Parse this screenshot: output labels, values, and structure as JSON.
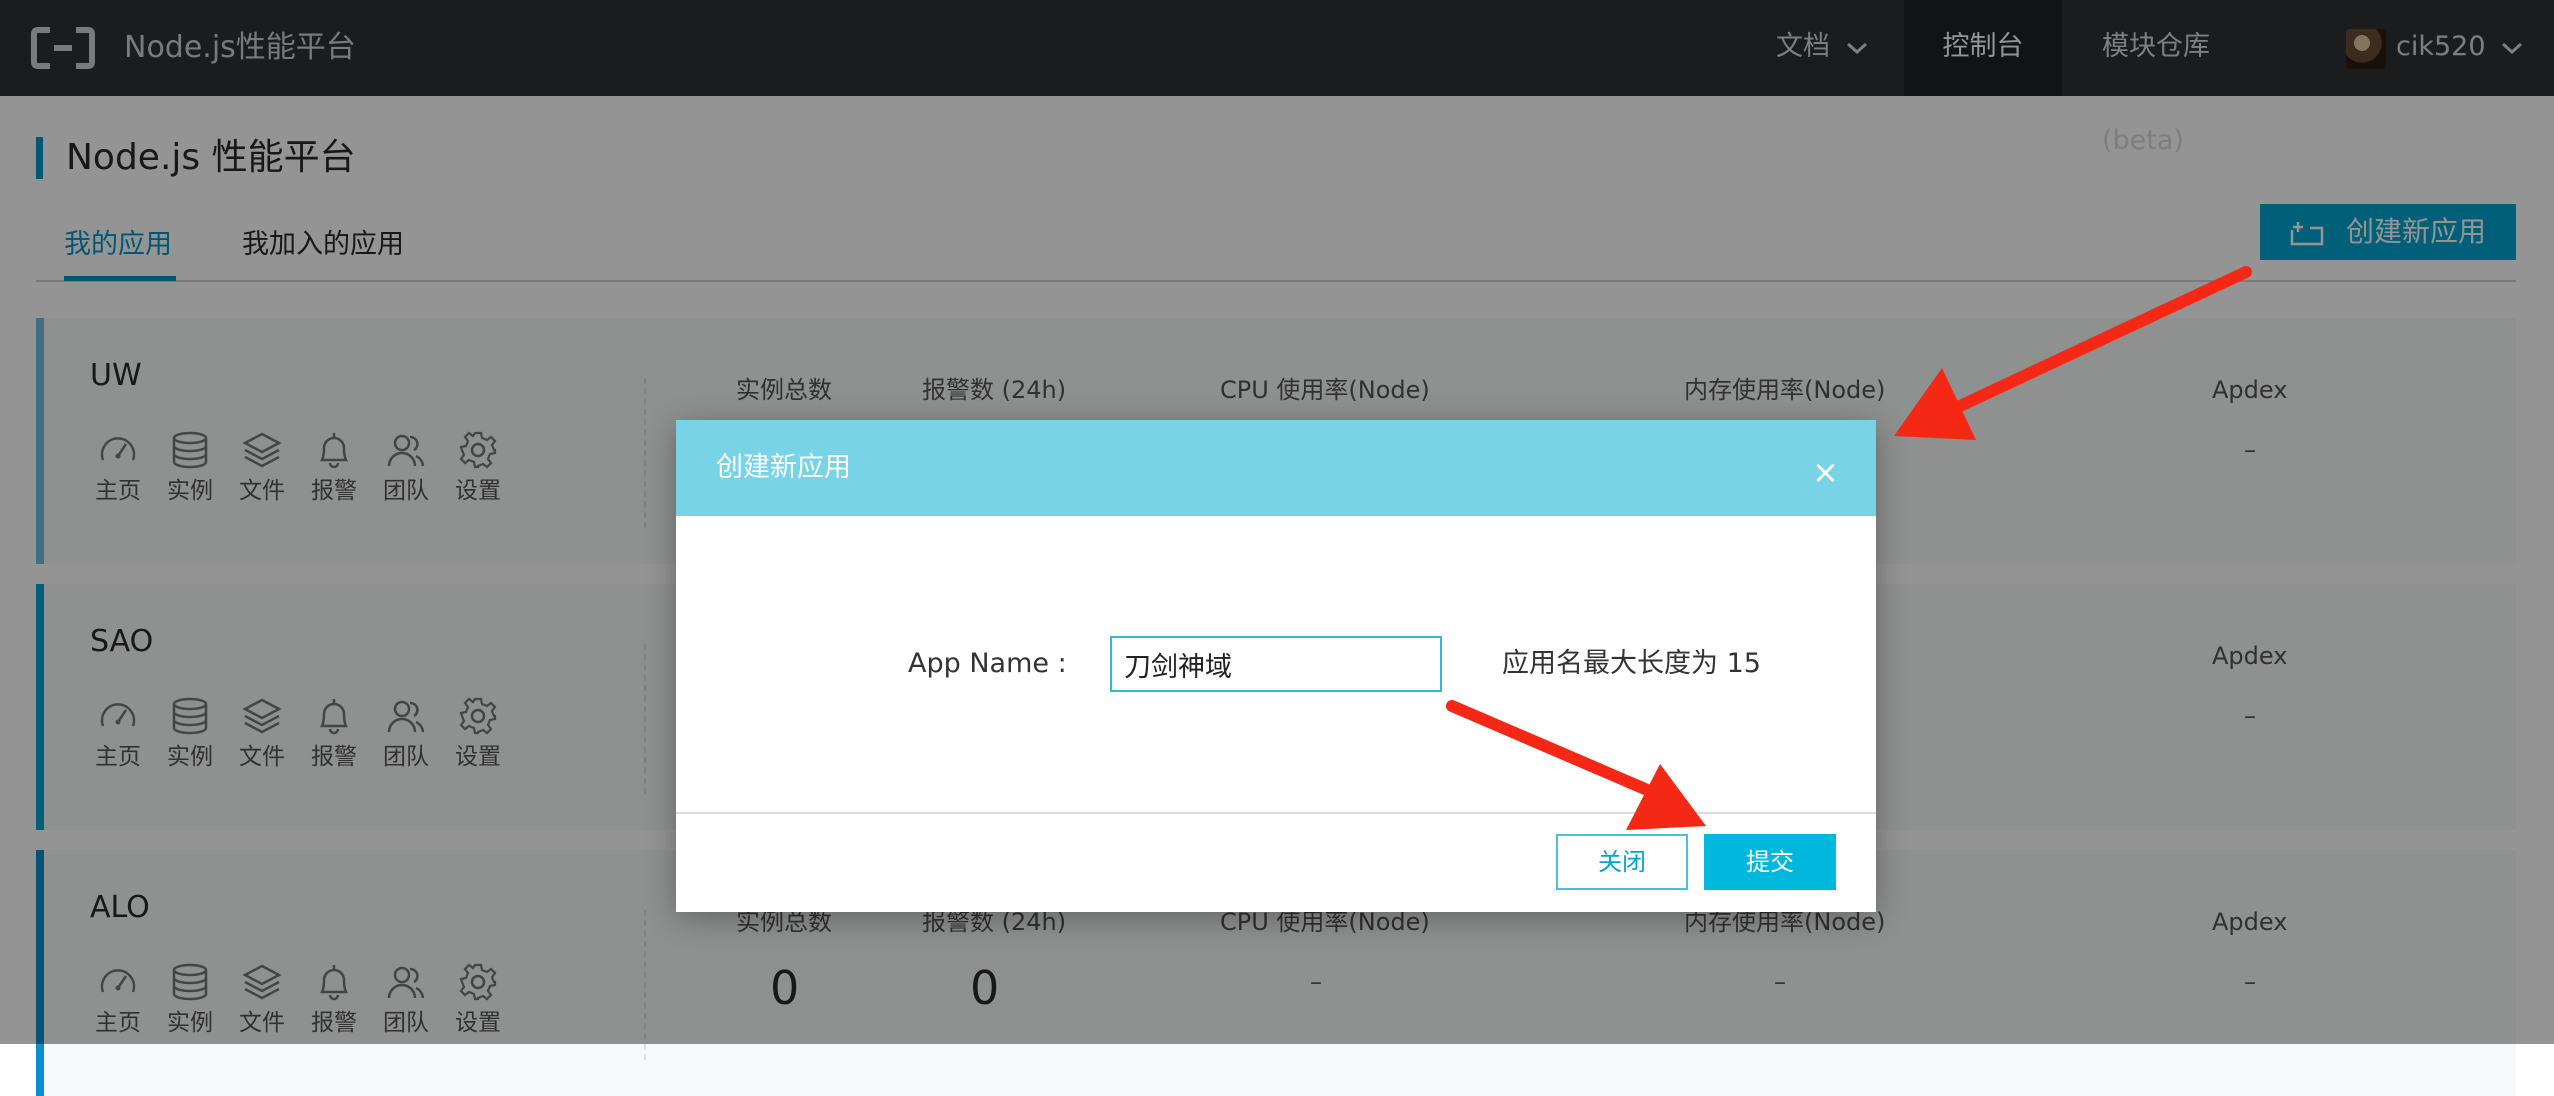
{
  "nav": {
    "brand": "Node.js性能平台",
    "docs": "文档",
    "console": "控制台",
    "modules": "模块仓库(beta)",
    "user": "cik520"
  },
  "page": {
    "title": "Node.js 性能平台",
    "tabs": [
      {
        "label": "我的应用",
        "active": true
      },
      {
        "label": "我加入的应用",
        "active": false
      }
    ],
    "create_button": "创建新应用"
  },
  "card_icons": [
    {
      "icon": "gauge-icon",
      "label": "主页"
    },
    {
      "icon": "database-icon",
      "label": "实例"
    },
    {
      "icon": "layers-icon",
      "label": "文件"
    },
    {
      "icon": "bell-icon",
      "label": "报警"
    },
    {
      "icon": "team-icon",
      "label": "团队"
    },
    {
      "icon": "gear-icon",
      "label": "设置"
    }
  ],
  "stat_headers": {
    "instances": "实例总数",
    "alarms": "报警数 (24h)",
    "cpu": "CPU 使用率(Node)",
    "memory": "内存使用率(Node)",
    "apdex": "Apdex"
  },
  "apps": [
    {
      "name": "UW",
      "apdex": "–",
      "visible_headers": [
        "instances",
        "alarms",
        "cpu",
        "memory",
        "apdex"
      ]
    },
    {
      "name": "SAO",
      "apdex": "–",
      "visible_headers": [
        "apdex"
      ]
    },
    {
      "name": "ALO",
      "instances": "0",
      "alarms": "0",
      "cpu": "–",
      "memory": "–",
      "apdex": "–"
    }
  ],
  "modal": {
    "title": "创建新应用",
    "close_glyph": "×",
    "label": "App Name :",
    "input_value": "刀剑神域",
    "hint": "应用名最大长度为 15",
    "cancel": "关闭",
    "submit": "提交"
  },
  "colors": {
    "accent": "#00a5d0",
    "modal_header": "#78d3e7",
    "nav_bg": "#2d3135",
    "annotation": "#f42814"
  }
}
